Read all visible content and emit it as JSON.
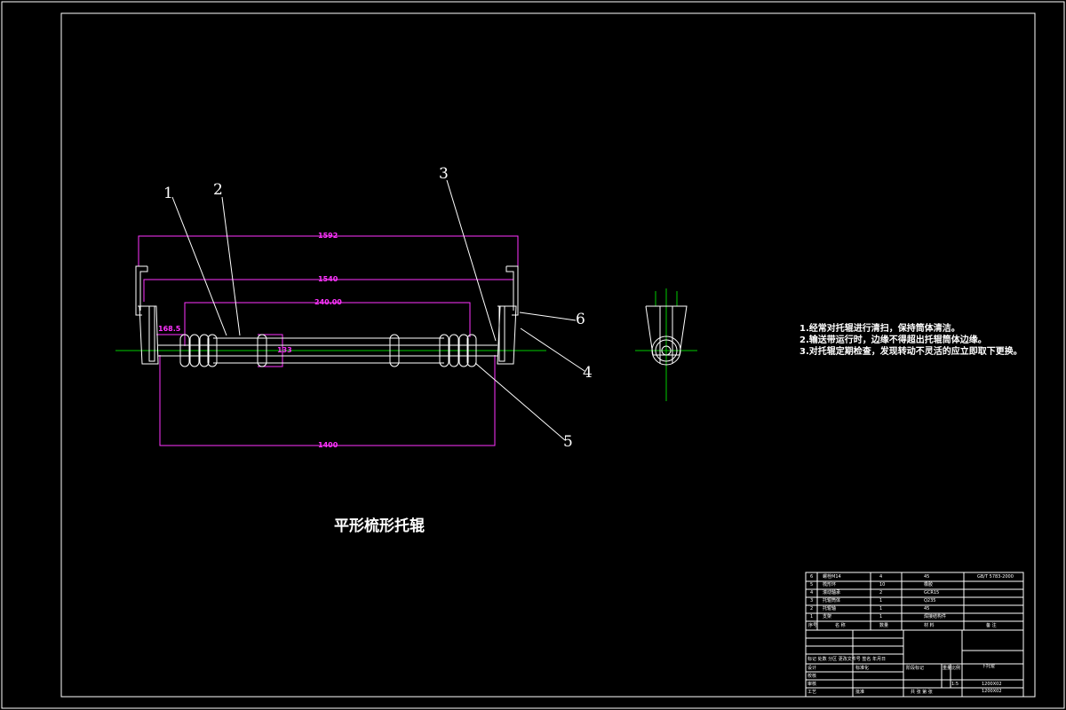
{
  "drawing": {
    "title": "平形梳形托辊",
    "notes": [
      "1.经常对托辊进行清扫，保持筒体清洁。",
      "2.输送带运行时，边缘不得超出托辊筒体边缘。",
      "3.对托辊定期检查，发现转动不灵活的应立即取下更换。"
    ],
    "callouts": [
      "1",
      "2",
      "3",
      "4",
      "5",
      "6"
    ],
    "dimensions": {
      "overall": "1592",
      "frame": "1540",
      "inner": "240.00",
      "roller_len": "1400",
      "side": "168.5",
      "diameter": "133"
    }
  },
  "title_block": {
    "bom_rows": [
      {
        "no": "6",
        "name": "螺栓M14",
        "qty": "4",
        "material": "45",
        "note": "GB/T 5783-2000"
      },
      {
        "no": "5",
        "name": "梳形环",
        "qty": "10",
        "material": "橡胶",
        "note": ""
      },
      {
        "no": "4",
        "name": "滚动轴承",
        "qty": "2",
        "material": "GCR15",
        "note": ""
      },
      {
        "no": "3",
        "name": "托辊筒体",
        "qty": "1",
        "material": "Q235",
        "note": ""
      },
      {
        "no": "2",
        "name": "托辊轴",
        "qty": "1",
        "material": "45",
        "note": ""
      },
      {
        "no": "1",
        "name": "支架",
        "qty": "1",
        "material": "焊接结构件",
        "note": ""
      }
    ],
    "bom_header": {
      "no": "序号",
      "name": "名  称",
      "qty": "数量",
      "material": "材  料",
      "note": "备  注"
    },
    "labels": {
      "revision": "标记  处数  分区  更改文件号  签名  年月日",
      "design": "设计",
      "standard": "标准化",
      "check": "校核",
      "review": "审核",
      "process": "工艺",
      "approve": "批准",
      "stage": "阶段标记",
      "weight": "重量",
      "scale": "比例",
      "scale_value": "1:5",
      "sheets": "共 张  第 张",
      "part_name": "下托辊",
      "code1": "1200X02",
      "code2": "1200X02"
    }
  },
  "colors": {
    "line": "#ffffff",
    "dimension": "#ff33ff",
    "centerline": "#00cc00"
  }
}
